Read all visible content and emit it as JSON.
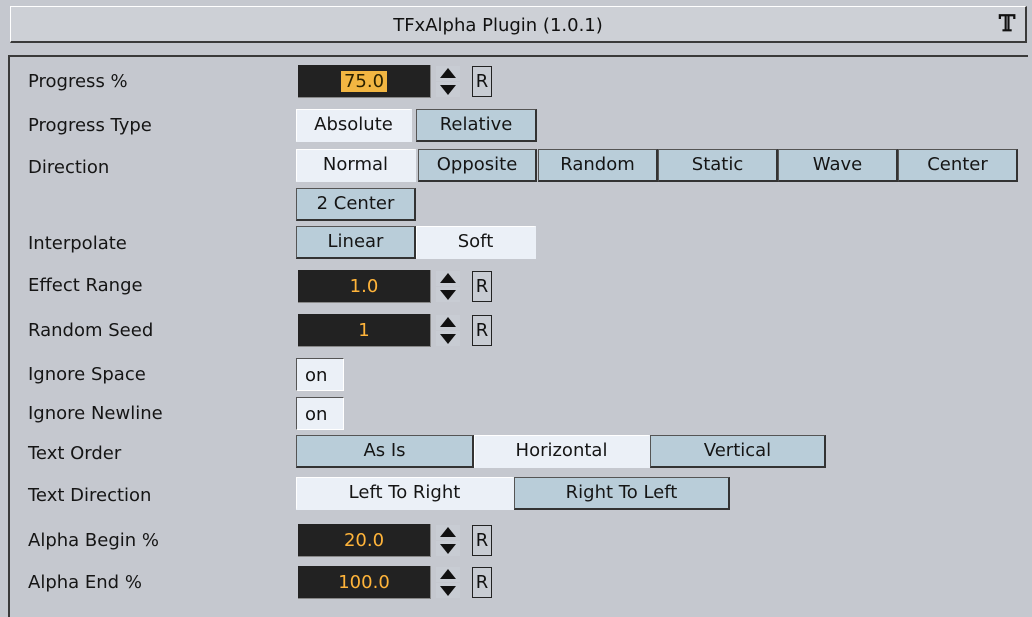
{
  "title": "TFxAlpha Plugin (1.0.1)",
  "title_icon": "plugin-logo-icon",
  "rows": {
    "progress": {
      "label": "Progress %",
      "value": "75.0",
      "reset": "R"
    },
    "progress_type": {
      "label": "Progress Type",
      "options": [
        "Absolute",
        "Relative"
      ],
      "selected": "Absolute"
    },
    "direction": {
      "label": "Direction",
      "options": [
        "Normal",
        "Opposite",
        "Random",
        "Static",
        "Wave",
        "Center",
        "2 Center"
      ],
      "selected": "Normal"
    },
    "interpolate": {
      "label": "Interpolate",
      "options": [
        "Linear",
        "Soft"
      ],
      "selected": "Soft"
    },
    "effect_range": {
      "label": "Effect Range",
      "value": "1.0",
      "reset": "R"
    },
    "random_seed": {
      "label": "Random Seed",
      "value": "1",
      "reset": "R"
    },
    "ignore_space": {
      "label": "Ignore Space",
      "value": "on"
    },
    "ignore_newline": {
      "label": "Ignore Newline",
      "value": "on"
    },
    "text_order": {
      "label": "Text Order",
      "options": [
        "As Is",
        "Horizontal",
        "Vertical"
      ],
      "selected": "Horizontal"
    },
    "text_direction": {
      "label": "Text Direction",
      "options": [
        "Left To Right",
        "Right To Left"
      ],
      "selected": "Left To Right"
    },
    "alpha_begin": {
      "label": "Alpha Begin %",
      "value": "20.0",
      "reset": "R"
    },
    "alpha_end": {
      "label": "Alpha End %",
      "value": "100.0",
      "reset": "R"
    }
  },
  "colors": {
    "panel_bg": "#c5c8cf",
    "field_bg": "#222222",
    "field_text": "#ffb43a",
    "button_bg": "#b9cdd9",
    "button_active_bg": "#ebf0f7",
    "selection": "#f2b642"
  }
}
